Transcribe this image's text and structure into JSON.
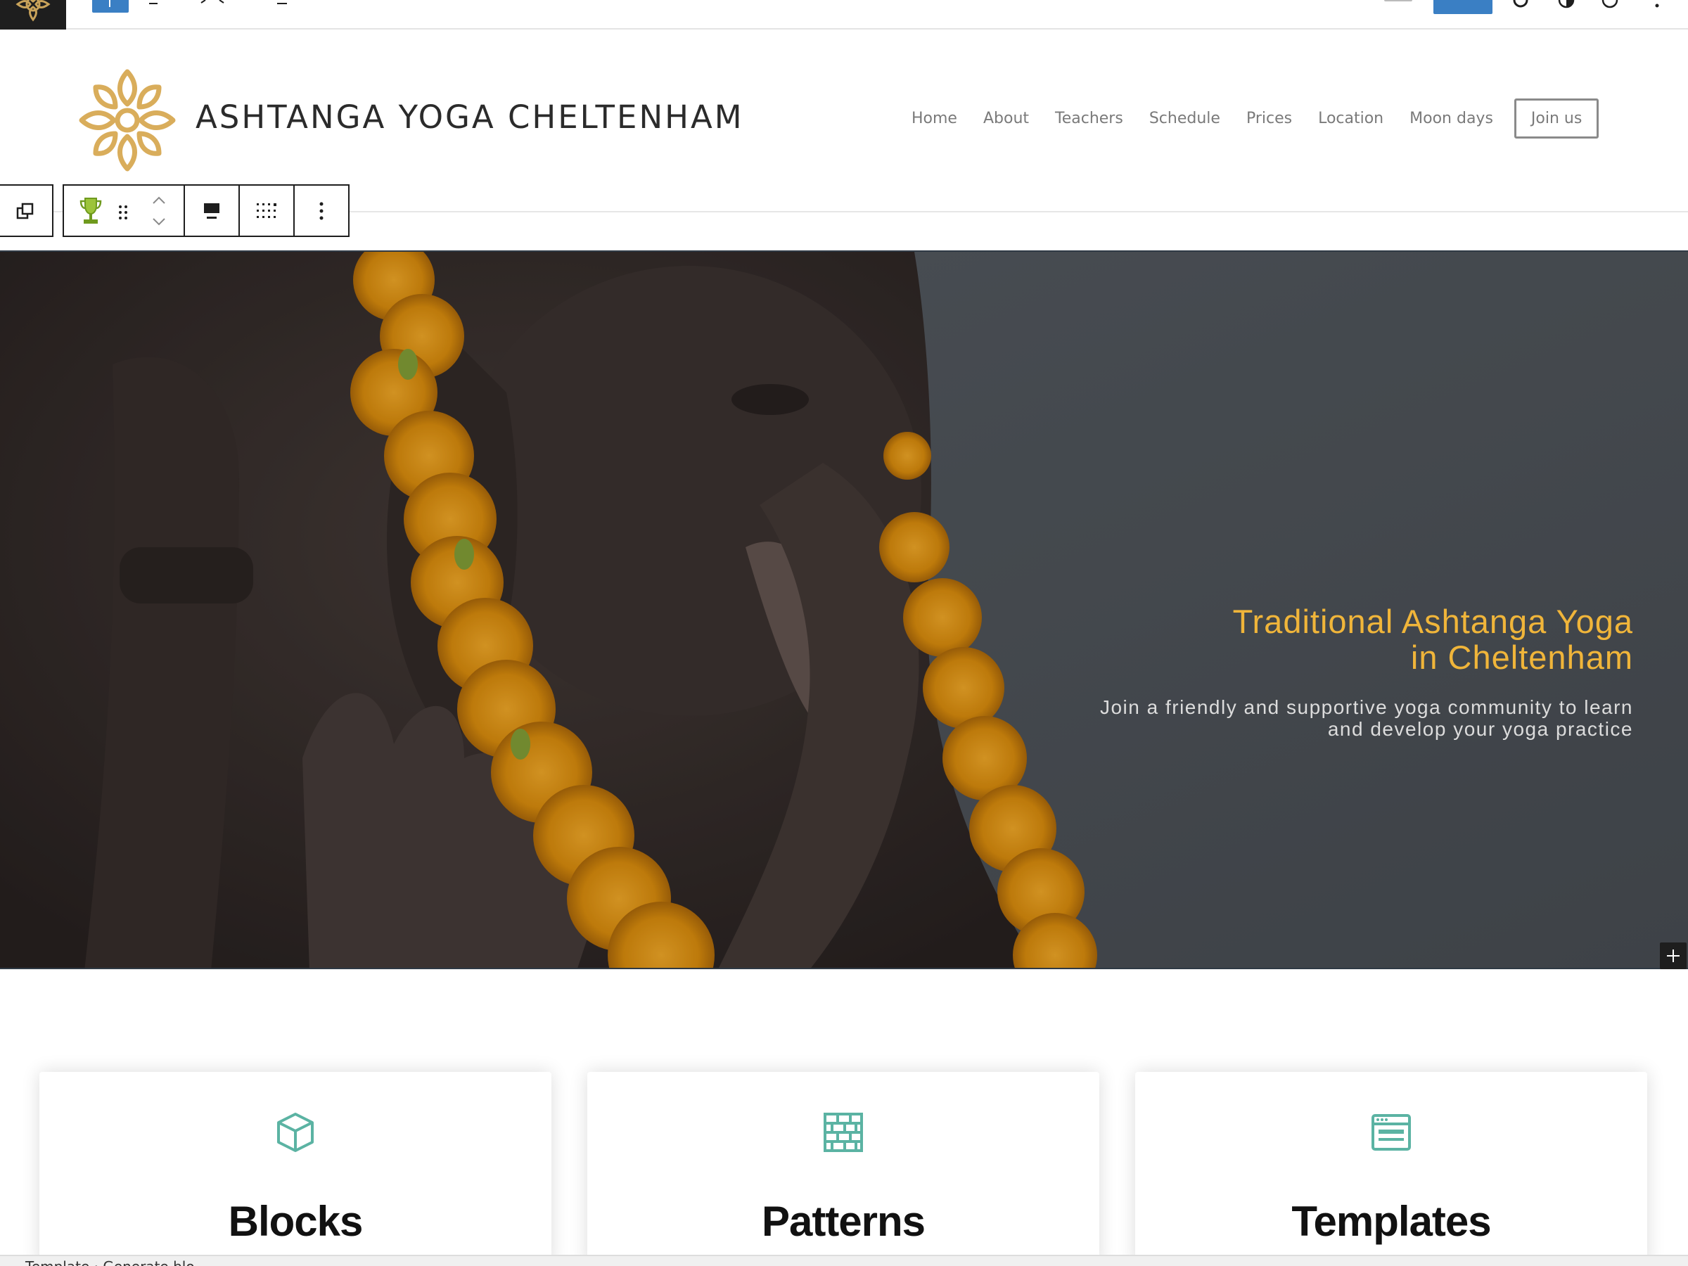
{
  "site": {
    "title": "ASHTANGA YOGA CHELTENHAM",
    "nav": [
      "Home",
      "About",
      "Teachers",
      "Schedule",
      "Prices",
      "Location",
      "Moon days"
    ],
    "join_label": "Join us",
    "accent_color": "#d9ad5b"
  },
  "hero": {
    "heading_line1": "Traditional Ashtanga Yoga",
    "heading_line2": "in Cheltenham",
    "sub_line1": "Join a friendly and supportive yoga community to learn",
    "sub_line2": "and develop your yoga practice",
    "heading_color": "#f0b53a"
  },
  "cards": [
    {
      "title": "Blocks",
      "icon": "cube-icon"
    },
    {
      "title": "Patterns",
      "icon": "brick-pattern-icon"
    },
    {
      "title": "Templates",
      "icon": "template-layout-icon"
    }
  ],
  "block_toolbar": {
    "icons": [
      "select-parent-icon",
      "trophy-icon",
      "drag-handle-icon",
      "move-up-icon",
      "move-down-icon",
      "align-icon",
      "grid-layout-icon",
      "more-options-icon"
    ]
  },
  "footer": {
    "breadcrumb": "Template · Generate blo"
  },
  "colors": {
    "primary_blue": "#3a7fc4",
    "card_icon": "#5bb3a3",
    "editor_dark": "#1e1e1e"
  }
}
